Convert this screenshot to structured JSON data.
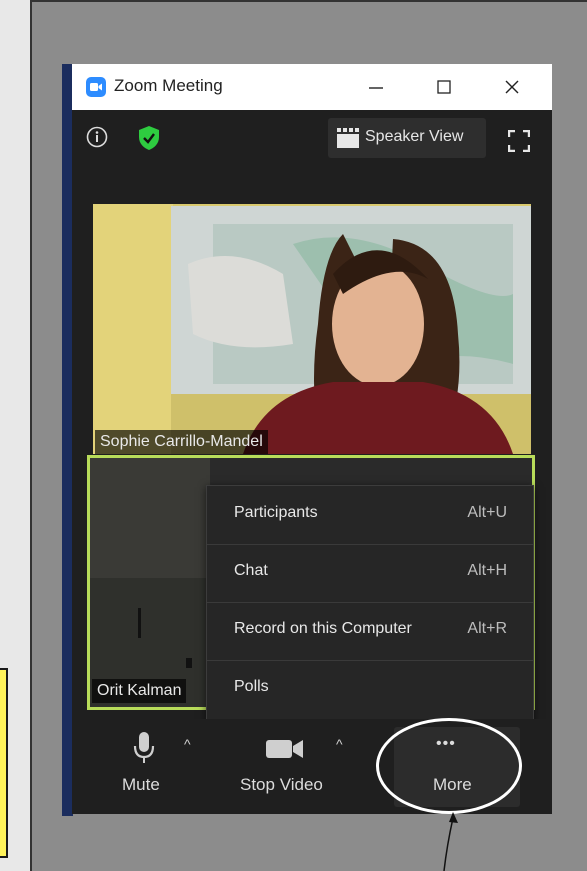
{
  "window": {
    "title": "Zoom Meeting"
  },
  "top_controls": {
    "speaker_view_label": "Speaker View"
  },
  "participants": [
    {
      "name": "Sophie Carrillo-Mandel"
    },
    {
      "name": "Orit Kalman"
    }
  ],
  "more_menu": {
    "items": [
      {
        "label": "Participants",
        "shortcut": "Alt+U"
      },
      {
        "label": "Chat",
        "shortcut": "Alt+H"
      },
      {
        "label": "Record on this Computer",
        "shortcut": "Alt+R"
      },
      {
        "label": "Polls",
        "shortcut": ""
      }
    ]
  },
  "toolbar": {
    "mute_label": "Mute",
    "stop_video_label": "Stop Video",
    "more_label": "More",
    "more_glyph": "•••",
    "chevron_glyph": "^"
  },
  "colors": {
    "active_speaker_border": "#b8dc5a",
    "encryption_shield": "#2ecc40",
    "app_blue": "#2d8cff",
    "annotation_note": "#fff35a"
  },
  "icons": {
    "app": "zoom-logo-icon",
    "info": "info-icon",
    "security": "shield-check-icon",
    "speaker_view": "speaker-view-grid-icon",
    "fullscreen": "fullscreen-icon",
    "mute": "microphone-icon",
    "video": "video-camera-icon"
  }
}
